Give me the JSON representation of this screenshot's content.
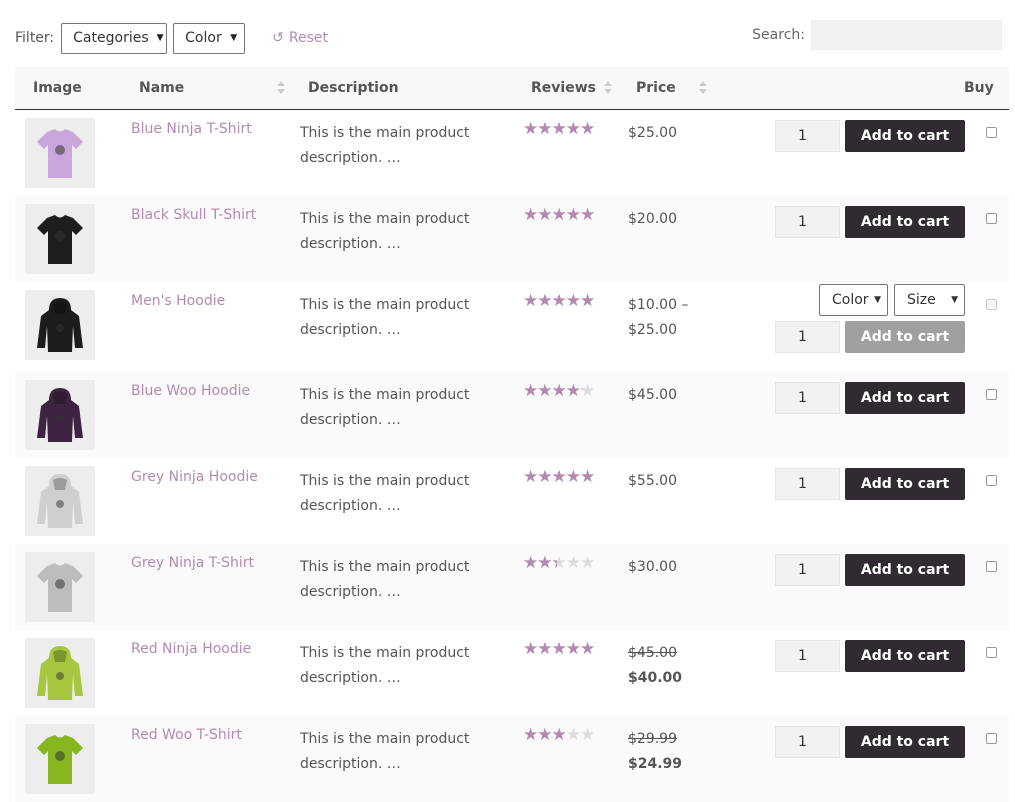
{
  "filter": {
    "label": "Filter:",
    "categories": "Categories",
    "color": "Color",
    "reset": "Reset"
  },
  "search": {
    "label": "Search:",
    "value": ""
  },
  "columns": {
    "image": "Image",
    "name": "Name",
    "description": "Description",
    "reviews": "Reviews",
    "price": "Price",
    "buy": "Buy"
  },
  "colors": {
    "accent": "#b48ab1",
    "button": "#322a33",
    "button_disabled": "#a29fa2"
  },
  "stars_glyph": "★★★★★",
  "products": [
    {
      "name": "Blue Ninja T-Shirt",
      "desc1": "This is the main product",
      "desc2": "description. …",
      "rating": 4.5,
      "price": "$25.00",
      "qty": "1",
      "button": "Add to cart",
      "image": "tshirt",
      "shirt_color": "#c9a6dc"
    },
    {
      "name": "Black Skull T-Shirt",
      "desc1": "This is the main product",
      "desc2": "description. …",
      "rating": 4.5,
      "price": "$20.00",
      "qty": "1",
      "button": "Add to cart",
      "image": "tshirt",
      "shirt_color": "#1e1e1e"
    },
    {
      "name": "Men's Hoodie",
      "desc1": "This is the main product",
      "desc2": "description. …",
      "rating": 5,
      "price_line1": "$10.00 –",
      "price_line2": "$25.00",
      "qty": "1",
      "button": "Add to cart",
      "color_select": "Color",
      "size_select": "Size",
      "image": "hoodie",
      "shirt_color": "#1c1c1c"
    },
    {
      "name": "Blue Woo Hoodie",
      "desc1": "This is the main product",
      "desc2": "description. …",
      "rating": 3.5,
      "price": "$45.00",
      "qty": "1",
      "button": "Add to cart",
      "image": "hoodie",
      "shirt_color": "#3d2440"
    },
    {
      "name": "Grey Ninja Hoodie",
      "desc1": "This is the main product",
      "desc2": "description. …",
      "rating": 4.5,
      "price": "$55.00",
      "qty": "1",
      "button": "Add to cart",
      "image": "hoodie",
      "shirt_color": "#cfcfcf"
    },
    {
      "name": "Grey Ninja T-Shirt",
      "desc1": "This is the main product",
      "desc2": "description. …",
      "rating": 2,
      "price": "$30.00",
      "qty": "1",
      "button": "Add to cart",
      "image": "tshirt",
      "shirt_color": "#bdbdbd"
    },
    {
      "name": "Red Ninja Hoodie",
      "desc1": "This is the main product",
      "desc2": "description. …",
      "rating": 4.5,
      "price_old": "$45.00",
      "price_new": "$40.00",
      "qty": "1",
      "button": "Add to cart",
      "image": "hoodie",
      "shirt_color": "#a6c640"
    },
    {
      "name": "Red Woo T-Shirt",
      "desc1": "This is the main product",
      "desc2": "description. …",
      "rating": 2.5,
      "price_old": "$29.99",
      "price_new": "$24.99",
      "qty": "1",
      "button": "Add to cart",
      "image": "tshirt",
      "shirt_color": "#86b51f"
    }
  ]
}
